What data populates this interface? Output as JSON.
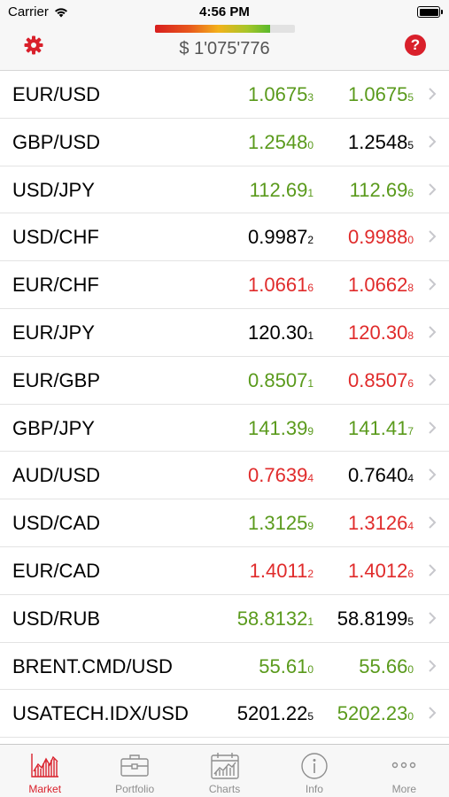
{
  "status_bar": {
    "carrier": "Carrier",
    "time": "4:56 PM"
  },
  "header": {
    "equity": "$ 1'075'776",
    "margin_gauge_level": 0.82,
    "help_glyph": "?",
    "icons": {
      "left": "gear-icon",
      "right": "help-icon"
    },
    "accent_color": "#d9202b"
  },
  "colors": {
    "up": "#5a9a1c",
    "down": "#e02b2b",
    "flat": "#000000"
  },
  "quotes": [
    {
      "symbol": "EUR/USD",
      "bid": "1.0675",
      "bid_pip": "3",
      "bid_dir": "up",
      "ask": "1.0675",
      "ask_pip": "5",
      "ask_dir": "up"
    },
    {
      "symbol": "GBP/USD",
      "bid": "1.2548",
      "bid_pip": "0",
      "bid_dir": "up",
      "ask": "1.2548",
      "ask_pip": "5",
      "ask_dir": "flat"
    },
    {
      "symbol": "USD/JPY",
      "bid": "112.69",
      "bid_pip": "1",
      "bid_dir": "up",
      "ask": "112.69",
      "ask_pip": "6",
      "ask_dir": "up"
    },
    {
      "symbol": "USD/CHF",
      "bid": "0.9987",
      "bid_pip": "2",
      "bid_dir": "flat",
      "ask": "0.9988",
      "ask_pip": "0",
      "ask_dir": "down"
    },
    {
      "symbol": "EUR/CHF",
      "bid": "1.0661",
      "bid_pip": "6",
      "bid_dir": "down",
      "ask": "1.0662",
      "ask_pip": "8",
      "ask_dir": "down"
    },
    {
      "symbol": "EUR/JPY",
      "bid": "120.30",
      "bid_pip": "1",
      "bid_dir": "flat",
      "ask": "120.30",
      "ask_pip": "8",
      "ask_dir": "down"
    },
    {
      "symbol": "EUR/GBP",
      "bid": "0.8507",
      "bid_pip": "1",
      "bid_dir": "up",
      "ask": "0.8507",
      "ask_pip": "6",
      "ask_dir": "down"
    },
    {
      "symbol": "GBP/JPY",
      "bid": "141.39",
      "bid_pip": "9",
      "bid_dir": "up",
      "ask": "141.41",
      "ask_pip": "7",
      "ask_dir": "up"
    },
    {
      "symbol": "AUD/USD",
      "bid": "0.7639",
      "bid_pip": "4",
      "bid_dir": "down",
      "ask": "0.7640",
      "ask_pip": "4",
      "ask_dir": "flat"
    },
    {
      "symbol": "USD/CAD",
      "bid": "1.3125",
      "bid_pip": "9",
      "bid_dir": "up",
      "ask": "1.3126",
      "ask_pip": "4",
      "ask_dir": "down"
    },
    {
      "symbol": "EUR/CAD",
      "bid": "1.4011",
      "bid_pip": "2",
      "bid_dir": "down",
      "ask": "1.4012",
      "ask_pip": "6",
      "ask_dir": "down"
    },
    {
      "symbol": "USD/RUB",
      "bid": "58.8132",
      "bid_pip": "1",
      "bid_dir": "up",
      "ask": "58.8199",
      "ask_pip": "5",
      "ask_dir": "flat"
    },
    {
      "symbol": "BRENT.CMD/USD",
      "bid": "55.61",
      "bid_pip": "0",
      "bid_dir": "up",
      "ask": "55.66",
      "ask_pip": "0",
      "ask_dir": "up"
    },
    {
      "symbol": "USATECH.IDX/USD",
      "bid": "5201.22",
      "bid_pip": "5",
      "bid_dir": "flat",
      "ask": "5202.23",
      "ask_pip": "0",
      "ask_dir": "up"
    }
  ],
  "tabs": [
    {
      "label": "Market",
      "icon": "market-chart-icon",
      "active": true
    },
    {
      "label": "Portfolio",
      "icon": "briefcase-icon",
      "active": false
    },
    {
      "label": "Charts",
      "icon": "calendar-chart-icon",
      "active": false
    },
    {
      "label": "Info",
      "icon": "info-icon",
      "active": false
    },
    {
      "label": "More",
      "icon": "more-dots-icon",
      "active": false
    }
  ]
}
